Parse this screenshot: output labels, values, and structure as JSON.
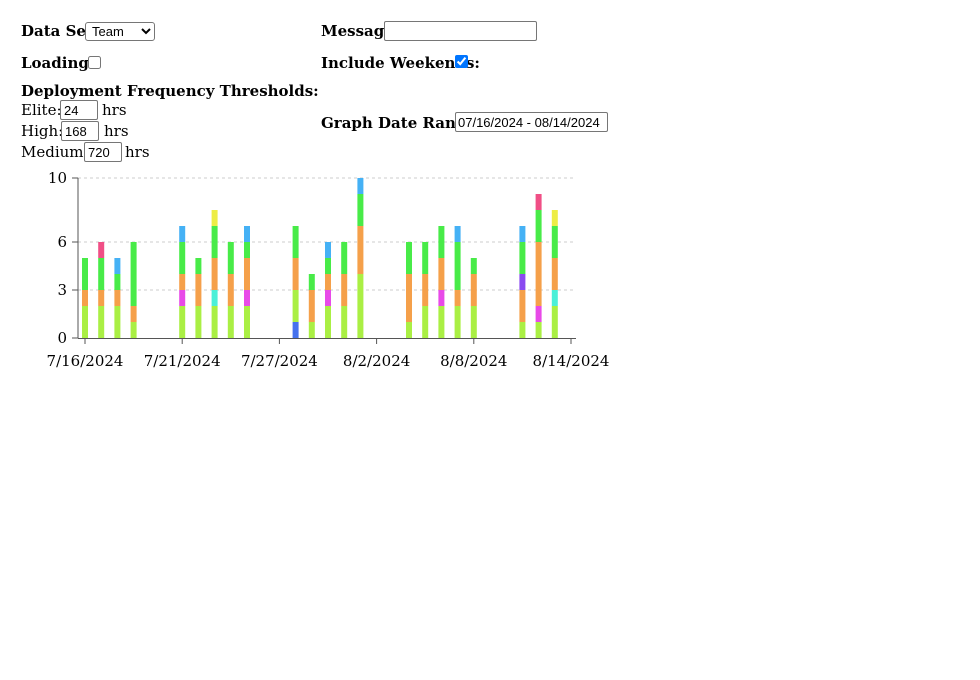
{
  "controls": {
    "dataset_label": "Data Set:",
    "dataset_value": "Team",
    "loading_label": "Loading:",
    "loading_checked": false,
    "thresholds_heading": "Deployment Frequency Thresholds:",
    "elite_label": "Elite:",
    "elite_value": "24",
    "high_label": "High:",
    "high_value": "168",
    "medium_label": "Medium:",
    "medium_value": "720",
    "hrs_unit": "hrs",
    "message_label": "Message:",
    "message_value": "",
    "weekends_label": "Include Weekends:",
    "weekends_checked": true,
    "daterange_label": "Graph Date Range:",
    "daterange_value": "07/16/2024 - 08/14/2024"
  },
  "chart_data": {
    "type": "bar",
    "stacked": true,
    "x_type": "date",
    "xlim": [
      "2024-07-16",
      "2024-08-14"
    ],
    "ylim": [
      0,
      10
    ],
    "y_ticks": [
      "0",
      "3",
      "6",
      "10"
    ],
    "y_tick_values": [
      0,
      3,
      6,
      10
    ],
    "x_ticks": [
      "7/16/2024",
      "7/21/2024",
      "7/27/2024",
      "8/2/2024",
      "8/8/2024",
      "8/14/2024"
    ],
    "x_tick_dates": [
      "2024-07-16",
      "2024-07-22",
      "2024-07-28",
      "2024-08-03",
      "2024-08-09",
      "2024-08-15"
    ],
    "grid": true,
    "colors": {
      "lime": "#aaef44",
      "orange": "#f5a04a",
      "green": "#48eb48",
      "blue": "#45b1f5",
      "pink": "#f04f86",
      "magenta": "#e84ae8",
      "yellow": "#eded45",
      "cyan": "#4bf0d8",
      "purple": "#8a4af0",
      "royal": "#4672ee"
    },
    "bars": [
      {
        "date": "2024-07-16",
        "segments": [
          {
            "c": "lime",
            "v": 2
          },
          {
            "c": "orange",
            "v": 1
          },
          {
            "c": "green",
            "v": 2
          }
        ]
      },
      {
        "date": "2024-07-17",
        "segments": [
          {
            "c": "lime",
            "v": 2
          },
          {
            "c": "orange",
            "v": 1
          },
          {
            "c": "green",
            "v": 2
          },
          {
            "c": "pink",
            "v": 1
          }
        ]
      },
      {
        "date": "2024-07-18",
        "segments": [
          {
            "c": "lime",
            "v": 2
          },
          {
            "c": "orange",
            "v": 1
          },
          {
            "c": "green",
            "v": 1
          },
          {
            "c": "blue",
            "v": 1
          }
        ]
      },
      {
        "date": "2024-07-19",
        "segments": [
          {
            "c": "lime",
            "v": 1
          },
          {
            "c": "orange",
            "v": 1
          },
          {
            "c": "green",
            "v": 4
          }
        ]
      },
      {
        "date": "2024-07-22",
        "segments": [
          {
            "c": "lime",
            "v": 2
          },
          {
            "c": "magenta",
            "v": 1
          },
          {
            "c": "orange",
            "v": 1
          },
          {
            "c": "green",
            "v": 2
          },
          {
            "c": "blue",
            "v": 1
          }
        ]
      },
      {
        "date": "2024-07-23",
        "segments": [
          {
            "c": "lime",
            "v": 2
          },
          {
            "c": "orange",
            "v": 2
          },
          {
            "c": "green",
            "v": 1
          }
        ]
      },
      {
        "date": "2024-07-24",
        "segments": [
          {
            "c": "lime",
            "v": 2
          },
          {
            "c": "cyan",
            "v": 1
          },
          {
            "c": "orange",
            "v": 2
          },
          {
            "c": "green",
            "v": 2
          },
          {
            "c": "yellow",
            "v": 1
          }
        ]
      },
      {
        "date": "2024-07-25",
        "segments": [
          {
            "c": "lime",
            "v": 2
          },
          {
            "c": "orange",
            "v": 2
          },
          {
            "c": "green",
            "v": 2
          }
        ]
      },
      {
        "date": "2024-07-26",
        "segments": [
          {
            "c": "lime",
            "v": 2
          },
          {
            "c": "magenta",
            "v": 1
          },
          {
            "c": "orange",
            "v": 2
          },
          {
            "c": "green",
            "v": 1
          },
          {
            "c": "blue",
            "v": 1
          }
        ]
      },
      {
        "date": "2024-07-29",
        "segments": [
          {
            "c": "royal",
            "v": 1
          },
          {
            "c": "lime",
            "v": 2
          },
          {
            "c": "orange",
            "v": 2
          },
          {
            "c": "green",
            "v": 2
          }
        ]
      },
      {
        "date": "2024-07-30",
        "segments": [
          {
            "c": "lime",
            "v": 1
          },
          {
            "c": "orange",
            "v": 2
          },
          {
            "c": "green",
            "v": 1
          }
        ]
      },
      {
        "date": "2024-07-31",
        "segments": [
          {
            "c": "lime",
            "v": 2
          },
          {
            "c": "magenta",
            "v": 1
          },
          {
            "c": "orange",
            "v": 1
          },
          {
            "c": "green",
            "v": 1
          },
          {
            "c": "blue",
            "v": 1
          }
        ]
      },
      {
        "date": "2024-08-01",
        "segments": [
          {
            "c": "lime",
            "v": 2
          },
          {
            "c": "orange",
            "v": 2
          },
          {
            "c": "green",
            "v": 2
          }
        ]
      },
      {
        "date": "2024-08-02",
        "segments": [
          {
            "c": "lime",
            "v": 4
          },
          {
            "c": "orange",
            "v": 3
          },
          {
            "c": "green",
            "v": 2
          },
          {
            "c": "blue",
            "v": 1
          }
        ]
      },
      {
        "date": "2024-08-05",
        "segments": [
          {
            "c": "lime",
            "v": 1
          },
          {
            "c": "orange",
            "v": 3
          },
          {
            "c": "green",
            "v": 2
          }
        ]
      },
      {
        "date": "2024-08-06",
        "segments": [
          {
            "c": "lime",
            "v": 2
          },
          {
            "c": "orange",
            "v": 2
          },
          {
            "c": "green",
            "v": 2
          }
        ]
      },
      {
        "date": "2024-08-07",
        "segments": [
          {
            "c": "lime",
            "v": 2
          },
          {
            "c": "magenta",
            "v": 1
          },
          {
            "c": "orange",
            "v": 2
          },
          {
            "c": "green",
            "v": 2
          }
        ]
      },
      {
        "date": "2024-08-08",
        "segments": [
          {
            "c": "lime",
            "v": 2
          },
          {
            "c": "orange",
            "v": 1
          },
          {
            "c": "green",
            "v": 3
          },
          {
            "c": "blue",
            "v": 1
          }
        ]
      },
      {
        "date": "2024-08-09",
        "segments": [
          {
            "c": "lime",
            "v": 2
          },
          {
            "c": "orange",
            "v": 2
          },
          {
            "c": "green",
            "v": 1
          }
        ]
      },
      {
        "date": "2024-08-12",
        "segments": [
          {
            "c": "lime",
            "v": 1
          },
          {
            "c": "orange",
            "v": 2
          },
          {
            "c": "purple",
            "v": 1
          },
          {
            "c": "green",
            "v": 2
          },
          {
            "c": "blue",
            "v": 1
          }
        ]
      },
      {
        "date": "2024-08-13",
        "segments": [
          {
            "c": "lime",
            "v": 1
          },
          {
            "c": "magenta",
            "v": 1
          },
          {
            "c": "orange",
            "v": 4
          },
          {
            "c": "green",
            "v": 2
          },
          {
            "c": "pink",
            "v": 1
          }
        ]
      },
      {
        "date": "2024-08-14",
        "segments": [
          {
            "c": "lime",
            "v": 2
          },
          {
            "c": "cyan",
            "v": 1
          },
          {
            "c": "orange",
            "v": 2
          },
          {
            "c": "green",
            "v": 2
          },
          {
            "c": "yellow",
            "v": 1
          }
        ]
      }
    ]
  }
}
